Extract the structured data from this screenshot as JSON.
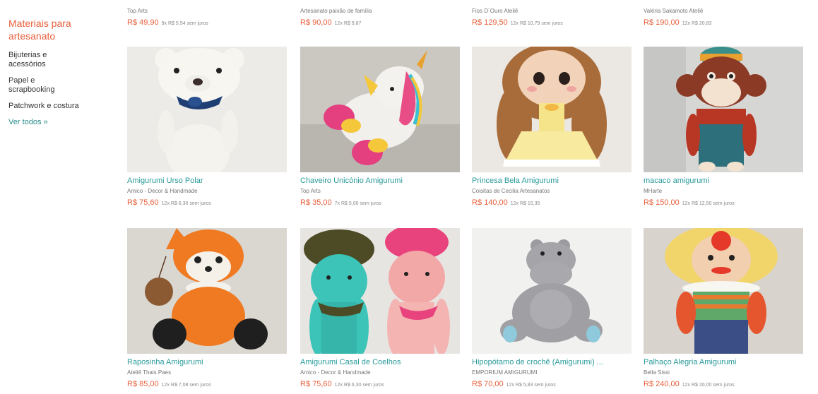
{
  "sidebar": {
    "title": "Materiais para artesanato",
    "items": [
      {
        "label": "Bijuterias e acessórios"
      },
      {
        "label": "Papel e scrapbooking"
      },
      {
        "label": "Patchwork e costura"
      }
    ],
    "more": "Ver todos »"
  },
  "top_row": [
    {
      "seller": "Top Arts",
      "price": "R$ 49,90",
      "installments": "9x R$ 5,54 sem juros"
    },
    {
      "seller": "Artesanato paixão de família",
      "price": "R$ 90,00",
      "installments": "12x R$ 9,87"
    },
    {
      "seller": "Fios D´Ouro Ateliê",
      "price": "R$ 129,50",
      "installments": "12x R$ 10,79 sem juros"
    },
    {
      "seller": "Valéria Sakamoto Ateliê",
      "price": "R$ 190,00",
      "installments": "12x R$ 20,83"
    }
  ],
  "products": [
    {
      "title": "Amigurumi Urso Polar",
      "seller": "Amico - Decor & Handmade",
      "price": "R$ 75,60",
      "installments": "12x R$ 6,30 sem juros",
      "image": "polar-bear-amigurumi"
    },
    {
      "title": "Chaveiro Unicónio Amigurumi",
      "seller": "Top Arts",
      "price": "R$ 35,00",
      "installments": "7x R$ 5,00 sem juros",
      "image": "unicorn-amigurumi"
    },
    {
      "title": "Princesa Bela Amigurumi",
      "seller": "Coisitas de Cecilia Artesanatos",
      "price": "R$ 140,00",
      "installments": "12x R$ 15,35",
      "image": "princess-doll-amigurumi"
    },
    {
      "title": "macaco amigurumi",
      "seller": "MHarte",
      "price": "R$ 150,00",
      "installments": "12x R$ 12,50 sem juros",
      "image": "monkey-amigurumi"
    },
    {
      "title": "Raposinha Amigurumi",
      "seller": "Ateliê Thais Paes",
      "price": "R$ 85,00",
      "installments": "12x R$ 7,08 sem juros",
      "image": "fox-amigurumi"
    },
    {
      "title": "Amigurumi Casal de Coelhos",
      "seller": "Amico - Decor & Handmade",
      "price": "R$ 75,60",
      "installments": "12x R$ 6,30 sem juros",
      "image": "bunny-couple-amigurumi"
    },
    {
      "title": "Hipopótamo de crochê (Amigurumi) ...",
      "seller": "EMPORIUM AMIGURUMI",
      "price": "R$ 70,00",
      "installments": "12x R$ 5,83 sem juros",
      "image": "hippo-amigurumi"
    },
    {
      "title": "Palhaço Alegria Amigurumi",
      "seller": "Bella Sissi",
      "price": "R$ 240,00",
      "installments": "12x R$ 20,00 sem juros",
      "image": "clown-amigurumi"
    }
  ],
  "colors": {
    "accent_orange": "#e8603c",
    "title_teal": "#2a9a9a"
  }
}
